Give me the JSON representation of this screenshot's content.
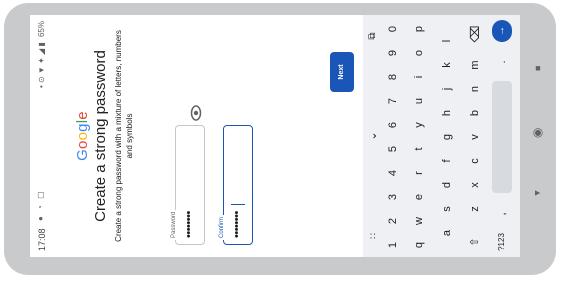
{
  "status_bar": {
    "time": "17:08",
    "icons": "● ◔ ▢",
    "right_icons": "• ⊙ ▼ ✦ ◢ ▮",
    "battery": "65%"
  },
  "brand": {
    "letters": [
      "G",
      "o",
      "o",
      "g",
      "l",
      "e"
    ],
    "colors": [
      "#4285f4",
      "#ea4335",
      "#fbbc05",
      "#4285f4",
      "#34a853",
      "#ea4335"
    ]
  },
  "heading": "Create a strong password",
  "subheading": "Create a strong password with a mixture of letters, numbers and symbols",
  "password_field": {
    "label": "Password",
    "value": "••••••••"
  },
  "confirm_field": {
    "label": "Confirm",
    "value": "••••••••"
  },
  "show_password_icon": "eye-icon",
  "next_button": "Next",
  "keyboard": {
    "top_icons": [
      "apps-icon",
      "chevron-down-icon",
      "clipboard-icon"
    ],
    "row_numbers": [
      "1",
      "2",
      "3",
      "4",
      "5",
      "6",
      "7",
      "8",
      "9",
      "0"
    ],
    "row1": [
      "q",
      "w",
      "e",
      "r",
      "t",
      "y",
      "u",
      "i",
      "o",
      "p"
    ],
    "row2": [
      "a",
      "s",
      "d",
      "f",
      "g",
      "h",
      "j",
      "k",
      "l"
    ],
    "row3": [
      "z",
      "x",
      "c",
      "v",
      "b",
      "n",
      "m"
    ],
    "shift": "⇧",
    "backspace": "⌫",
    "symbols": "?123",
    "comma": ",",
    "period": ".",
    "enter": "→"
  },
  "nav": {
    "back": "▲",
    "home": "◉",
    "recents": "■"
  }
}
